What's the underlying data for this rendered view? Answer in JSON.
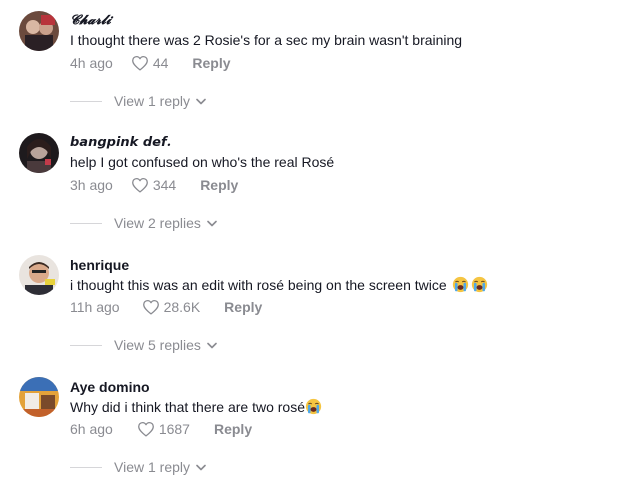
{
  "comments": [
    {
      "username": "𝓒𝓱𝓪𝓻𝓵𝓲 ",
      "text": "I thought there was 2 Rosie's for a sec my brain wasn't braining",
      "time": "4h ago",
      "likes": "44",
      "reply_label": "Reply",
      "view_replies": "View 1 reply",
      "emoji_count": 0
    },
    {
      "username": "𝙗𝙖𝙣𝙜𝙥𝙞𝙣𝙠 𝙙𝙚𝙛.",
      "text": "help I got confused on who's the real Rosé",
      "time": "3h ago",
      "likes": "344",
      "reply_label": "Reply",
      "view_replies": "View 2 replies",
      "emoji_count": 0
    },
    {
      "username": "henrique",
      "text": "i thought this was an edit with rosé being on the screen twice",
      "time": "11h ago",
      "likes": "28.6K",
      "reply_label": "Reply",
      "view_replies": "View 5 replies",
      "emoji_count": 2,
      "emoji": "loudly-crying-face"
    },
    {
      "username": "Aye domino",
      "text": "Why did i think that there are two rosé",
      "time": "6h ago",
      "likes": "1687",
      "reply_label": "Reply",
      "view_replies": "View 1 reply",
      "emoji_count": 1,
      "emoji": "loudly-crying-face"
    }
  ],
  "icons": {
    "like": "heart-outline-icon",
    "expand": "chevron-down-icon"
  },
  "colors": {
    "text": "#161823",
    "muted": "#8a8b91",
    "divider": "#d6d6d9"
  }
}
